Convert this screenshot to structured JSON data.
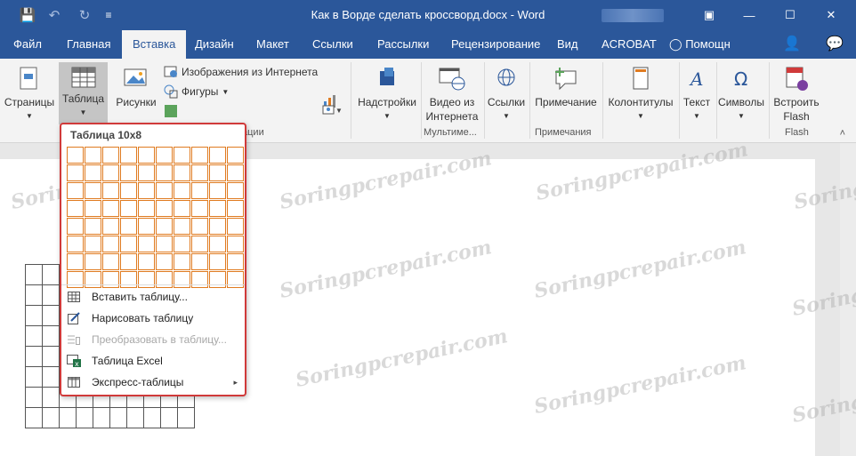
{
  "window": {
    "title": "Как в Ворде сделать кроссворд.docx - Word",
    "minimize_icon": "—",
    "maximize_icon": "☐",
    "close_icon": "✕",
    "restore_ribbon_icon": "▣"
  },
  "qat": {
    "save_icon": "💾",
    "undo_icon": "↶",
    "redo_icon": "↻",
    "more_icon": "≡"
  },
  "tabs": {
    "file": "Файл",
    "home": "Главная",
    "insert": "Вставка",
    "design": "Дизайн",
    "layout": "Макет",
    "references": "Ссылки",
    "mailings": "Рассылки",
    "review": "Рецензирование",
    "view": "Вид",
    "acrobat": "ACROBAT",
    "tellme": "Помощн",
    "share_icon": "👤",
    "comment_icon": "💬"
  },
  "ribbon": {
    "pages": "Страницы",
    "table": "Таблица",
    "pictures": "Рисунки",
    "online_pictures": "Изображения из Интернета",
    "shapes": "Фигуры",
    "illustrations_group": "ации",
    "addins": "Надстройки",
    "online_video_line1": "Видео из",
    "online_video_line2": "Интернета",
    "media_group": "Мультиме...",
    "links": "Ссылки",
    "comment": "Примечание",
    "comments_group": "Примечания",
    "header_footer": "Колонтитулы",
    "text": "Текст",
    "symbols": "Символы",
    "flash_line1": "Встроить",
    "flash_line2": "Flash",
    "flash_group": "Flash",
    "collapse_icon": "˄"
  },
  "dropdown": {
    "title": "Таблица 10x8",
    "grid_cols": 10,
    "grid_rows": 8,
    "items": [
      {
        "label": "Вставить таблицу...",
        "enabled": true,
        "submenu": false
      },
      {
        "label": "Нарисовать таблицу",
        "enabled": true,
        "submenu": false
      },
      {
        "label": "Преобразовать в таблицу...",
        "enabled": false,
        "submenu": false
      },
      {
        "label": "Таблица Excel",
        "enabled": true,
        "submenu": false
      },
      {
        "label": "Экспресс-таблицы",
        "enabled": true,
        "submenu": true
      }
    ],
    "submenu_arrow": "▸"
  },
  "document": {
    "table_cols": 10,
    "table_rows": 8
  },
  "watermark_text": "Soringpcrepair.com",
  "colors": {
    "title_bar": "#2b579a",
    "ribbon": "#f3f3f3",
    "highlight_border": "#d03a3a",
    "grid_cell_border": "#e07b20"
  }
}
